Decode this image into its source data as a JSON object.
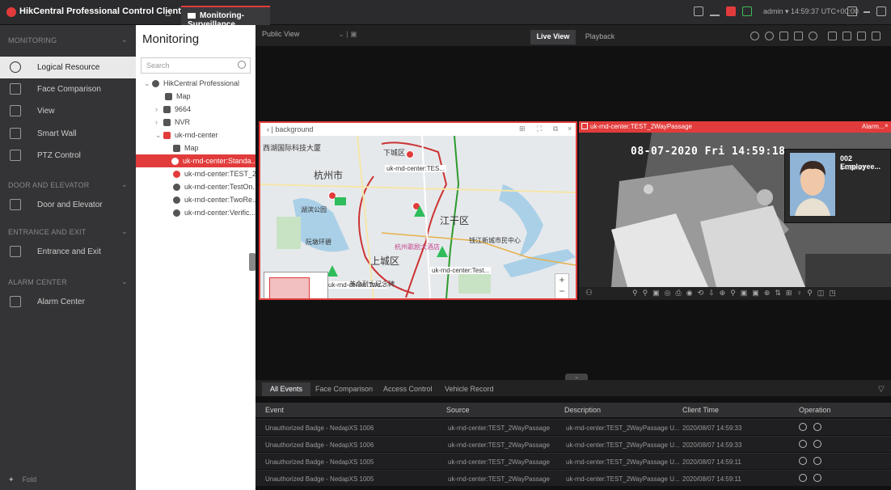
{
  "titlebar": {
    "app_title": "HikCentral Professional Control Client",
    "tab_label": "Monitoring-Surveillance",
    "user_info": "admin ▾  14:59:37 UTC+00:00"
  },
  "sidebar": {
    "sections": [
      {
        "title": "MONITORING",
        "items": [
          {
            "label": "Logical Resource",
            "icon": "globe-icon"
          },
          {
            "label": "Face Comparison",
            "icon": "face-icon"
          },
          {
            "label": "View",
            "icon": "view-icon"
          },
          {
            "label": "Smart Wall",
            "icon": "wall-icon"
          },
          {
            "label": "PTZ Control",
            "icon": "ptz-icon"
          }
        ]
      },
      {
        "title": "DOOR AND ELEVATOR",
        "items": [
          {
            "label": "Door and Elevator",
            "icon": "door-icon"
          }
        ]
      },
      {
        "title": "ENTRANCE AND EXIT",
        "items": [
          {
            "label": "Entrance and Exit",
            "icon": "barrier-icon"
          }
        ]
      },
      {
        "title": "ALARM CENTER",
        "items": [
          {
            "label": "Alarm Center",
            "icon": "alarm-icon"
          }
        ]
      }
    ],
    "fold_label": "Fold"
  },
  "tree": {
    "title": "Monitoring",
    "search_placeholder": "Search",
    "nodes": [
      {
        "label": "HikCentral Professional",
        "indent": 0
      },
      {
        "label": "Map",
        "indent": 1
      },
      {
        "label": "9664",
        "indent": 1
      },
      {
        "label": "NVR",
        "indent": 1
      },
      {
        "label": "uk-rnd-center",
        "indent": 1
      },
      {
        "label": "Map",
        "indent": 2
      },
      {
        "label": "uk-rnd-center:Standa...",
        "indent": 2,
        "selected": true
      },
      {
        "label": "uk-rnd-center:TEST_2...",
        "indent": 2
      },
      {
        "label": "uk-rnd-center:TestOn...",
        "indent": 2
      },
      {
        "label": "uk-rnd-center:TwoRe...",
        "indent": 2
      },
      {
        "label": "uk-rnd-center:Verific...",
        "indent": 2
      }
    ]
  },
  "toolbar": {
    "public_view": "Public View",
    "live_view": "Live View",
    "playback": "Playback"
  },
  "map_window": {
    "title": "background",
    "labels": {
      "city": "杭州市",
      "district1": "江干区",
      "district2": "上城区",
      "area1": "下城区",
      "device1": "uk-rnd-center:TES...",
      "device2": "uk-rnd-center:Test...",
      "device3": "uk-rnd-center:Two...",
      "poi1": "西湖国际科技大厦",
      "poi2": "湖滨公园",
      "poi3": "钱江新城市民中心",
      "poi4": "杭州歌剧大酒店",
      "poi5": "阮墩环碧",
      "poi6": "革命烈士纪念碑"
    }
  },
  "camera_window": {
    "title": "uk-rnd-center:TEST_2WayPassage",
    "alarm_label": "Alarm...",
    "osd_datetime": "08-07-2020 Fri 14:59:18",
    "face_name": "002 Employee...",
    "face_time": "14:59:33"
  },
  "events": {
    "tabs": [
      "All Events",
      "Face Comparison",
      "Access Control",
      "Vehicle Record"
    ],
    "columns": [
      "Event",
      "Source",
      "Description",
      "Client Time",
      "Operation"
    ],
    "rows": [
      {
        "event": "Unauthorized Badge - NedapXS 1006",
        "source": "uk-rnd-center:TEST_2WayPassage",
        "description": "uk-rnd-center:TEST_2WayPassage U...",
        "time": "2020/08/07 14:59:33"
      },
      {
        "event": "Unauthorized Badge - NedapXS 1006",
        "source": "uk-rnd-center:TEST_2WayPassage",
        "description": "uk-rnd-center:TEST_2WayPassage U...",
        "time": "2020/08/07 14:59:33"
      },
      {
        "event": "Unauthorized Badge - NedapXS 1005",
        "source": "uk-rnd-center:TEST_2WayPassage",
        "description": "uk-rnd-center:TEST_2WayPassage U...",
        "time": "2020/08/07 14:59:11"
      },
      {
        "event": "Unauthorized Badge - NedapXS 1005",
        "source": "uk-rnd-center:TEST_2WayPassage",
        "description": "uk-rnd-center:TEST_2WayPassage U...",
        "time": "2020/08/07 14:59:11"
      }
    ]
  },
  "colors": {
    "accent": "#e23b3b",
    "active_nav": "#e9e9e9",
    "map_green": "#2ebd5a"
  }
}
